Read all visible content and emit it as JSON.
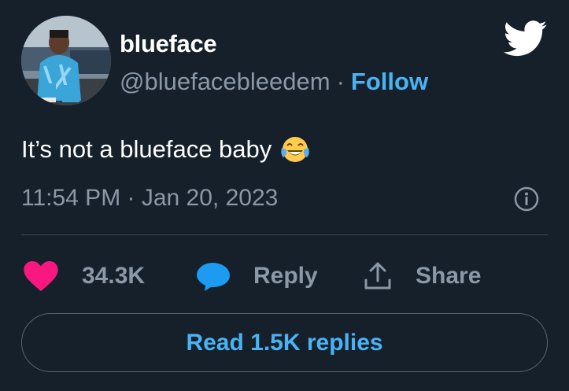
{
  "author": {
    "display_name": "blueface",
    "handle": "@bluefacebleedem",
    "separator": "·",
    "follow_label": "Follow"
  },
  "tweet": {
    "text": "It’s not a blueface baby",
    "emoji": "face-with-tears-of-joy",
    "timestamp": "11:54 PM · Jan 20, 2023"
  },
  "actions": {
    "likes_count": "34.3K",
    "reply_label": "Reply",
    "share_label": "Share"
  },
  "read_replies_label": "Read 1.5K replies",
  "colors": {
    "background": "#15202b",
    "accent": "#4ab3f4",
    "like": "#f91880",
    "reply_bubble": "#1d9bf0",
    "muted": "#8b98a5"
  },
  "icons": [
    "twitter-bird-icon",
    "info-icon",
    "heart-icon",
    "reply-bubble-icon",
    "share-icon"
  ]
}
